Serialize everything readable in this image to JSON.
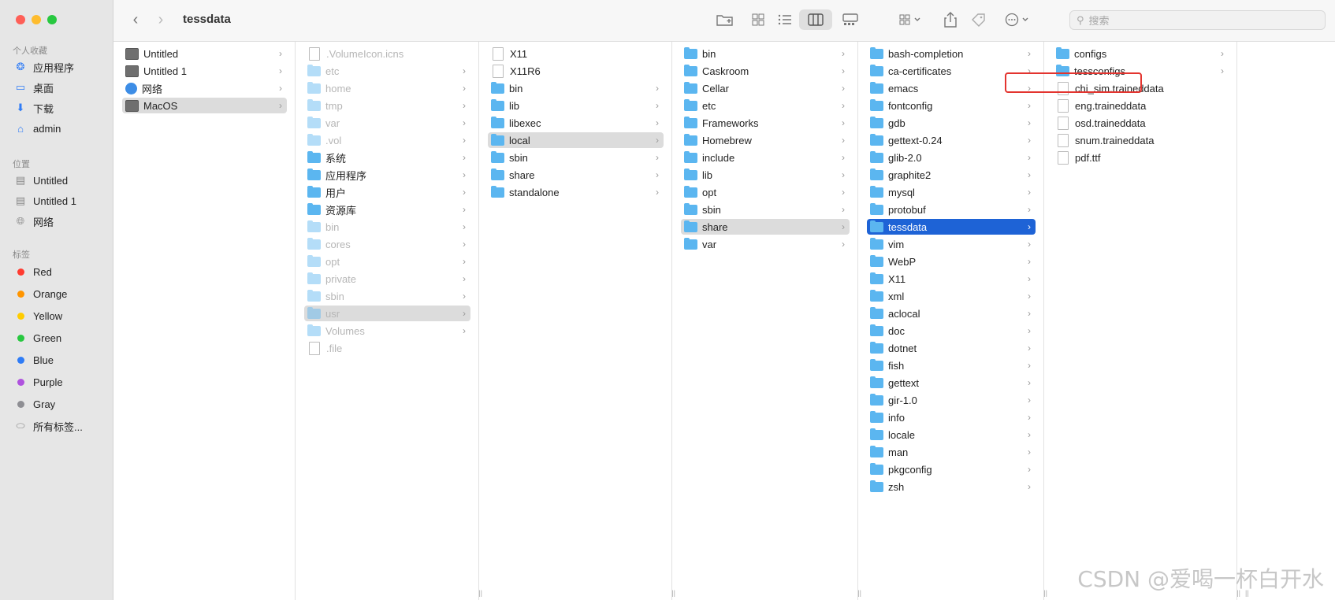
{
  "window": {
    "title": "tessdata"
  },
  "sidebar": {
    "favorites_label": "个人收藏",
    "favorites": [
      {
        "label": "应用程序",
        "icon": "apps-icon"
      },
      {
        "label": "桌面",
        "icon": "desktop-icon"
      },
      {
        "label": "下载",
        "icon": "download-icon"
      },
      {
        "label": "admin",
        "icon": "home-icon"
      }
    ],
    "locations_label": "位置",
    "locations": [
      {
        "label": "Untitled",
        "icon": "drive-icon"
      },
      {
        "label": "Untitled 1",
        "icon": "drive-icon"
      },
      {
        "label": "网络",
        "icon": "network-icon"
      }
    ],
    "tags_label": "标签",
    "tags": [
      {
        "label": "Red",
        "color": "#ff3b30"
      },
      {
        "label": "Orange",
        "color": "#ff9500"
      },
      {
        "label": "Yellow",
        "color": "#ffcc00"
      },
      {
        "label": "Green",
        "color": "#28c840"
      },
      {
        "label": "Blue",
        "color": "#2f7cf6"
      },
      {
        "label": "Purple",
        "color": "#af52de"
      },
      {
        "label": "Gray",
        "color": "#8e8e93"
      }
    ],
    "all_tags_label": "所有标签..."
  },
  "toolbar": {
    "search_placeholder": "搜索"
  },
  "columns": [
    {
      "items": [
        {
          "label": "Untitled",
          "kind": "disk",
          "chevron": true
        },
        {
          "label": "Untitled 1",
          "kind": "disk",
          "chevron": true
        },
        {
          "label": "网络",
          "kind": "globe",
          "chevron": true
        },
        {
          "label": "MacOS",
          "kind": "disk",
          "chevron": true,
          "state": "selected-gray"
        }
      ]
    },
    {
      "items": [
        {
          "label": ".VolumeIcon.icns",
          "kind": "file",
          "dim": true
        },
        {
          "label": "etc",
          "kind": "folder",
          "dim": true,
          "chevron": true
        },
        {
          "label": "home",
          "kind": "folder",
          "dim": true,
          "chevron": true
        },
        {
          "label": "tmp",
          "kind": "folder",
          "dim": true,
          "chevron": true
        },
        {
          "label": "var",
          "kind": "folder",
          "dim": true,
          "chevron": true
        },
        {
          "label": ".vol",
          "kind": "folder",
          "dim": true,
          "chevron": true
        },
        {
          "label": "系统",
          "kind": "folder",
          "chevron": true
        },
        {
          "label": "应用程序",
          "kind": "folder",
          "chevron": true
        },
        {
          "label": "用户",
          "kind": "folder",
          "chevron": true
        },
        {
          "label": "资源库",
          "kind": "folder",
          "chevron": true
        },
        {
          "label": "bin",
          "kind": "folder",
          "dim": true,
          "chevron": true
        },
        {
          "label": "cores",
          "kind": "folder",
          "dim": true,
          "chevron": true
        },
        {
          "label": "opt",
          "kind": "folder",
          "dim": true,
          "chevron": true
        },
        {
          "label": "private",
          "kind": "folder",
          "dim": true,
          "chevron": true
        },
        {
          "label": "sbin",
          "kind": "folder",
          "dim": true,
          "chevron": true
        },
        {
          "label": "usr",
          "kind": "folder",
          "dim": true,
          "chevron": true,
          "state": "selected-gray"
        },
        {
          "label": "Volumes",
          "kind": "folder",
          "dim": true,
          "chevron": true
        },
        {
          "label": ".file",
          "kind": "file",
          "dim": true
        }
      ]
    },
    {
      "items": [
        {
          "label": "X11",
          "kind": "file"
        },
        {
          "label": "X11R6",
          "kind": "file"
        },
        {
          "label": "bin",
          "kind": "folder",
          "chevron": true
        },
        {
          "label": "lib",
          "kind": "folder",
          "chevron": true
        },
        {
          "label": "libexec",
          "kind": "folder",
          "chevron": true
        },
        {
          "label": "local",
          "kind": "folder",
          "chevron": true,
          "state": "selected-gray"
        },
        {
          "label": "sbin",
          "kind": "folder",
          "chevron": true
        },
        {
          "label": "share",
          "kind": "folder",
          "chevron": true
        },
        {
          "label": "standalone",
          "kind": "folder",
          "chevron": true
        }
      ]
    },
    {
      "items": [
        {
          "label": "bin",
          "kind": "folder",
          "chevron": true
        },
        {
          "label": "Caskroom",
          "kind": "folder",
          "chevron": true
        },
        {
          "label": "Cellar",
          "kind": "folder",
          "chevron": true
        },
        {
          "label": "etc",
          "kind": "folder",
          "chevron": true
        },
        {
          "label": "Frameworks",
          "kind": "folder",
          "chevron": true
        },
        {
          "label": "Homebrew",
          "kind": "folder",
          "chevron": true
        },
        {
          "label": "include",
          "kind": "folder",
          "chevron": true
        },
        {
          "label": "lib",
          "kind": "folder",
          "chevron": true
        },
        {
          "label": "opt",
          "kind": "folder",
          "chevron": true
        },
        {
          "label": "sbin",
          "kind": "folder",
          "chevron": true
        },
        {
          "label": "share",
          "kind": "folder",
          "chevron": true,
          "state": "selected-gray"
        },
        {
          "label": "var",
          "kind": "folder",
          "chevron": true
        }
      ]
    },
    {
      "items": [
        {
          "label": "bash-completion",
          "kind": "folder",
          "chevron": true
        },
        {
          "label": "ca-certificates",
          "kind": "folder",
          "chevron": true
        },
        {
          "label": "emacs",
          "kind": "folder",
          "chevron": true
        },
        {
          "label": "fontconfig",
          "kind": "folder",
          "chevron": true
        },
        {
          "label": "gdb",
          "kind": "folder",
          "chevron": true
        },
        {
          "label": "gettext-0.24",
          "kind": "folder",
          "chevron": true
        },
        {
          "label": "glib-2.0",
          "kind": "folder",
          "chevron": true
        },
        {
          "label": "graphite2",
          "kind": "folder",
          "chevron": true
        },
        {
          "label": "mysql",
          "kind": "folder",
          "chevron": true
        },
        {
          "label": "protobuf",
          "kind": "folder",
          "chevron": true
        },
        {
          "label": "tessdata",
          "kind": "folder",
          "chevron": true,
          "state": "selected-blue"
        },
        {
          "label": "vim",
          "kind": "folder",
          "chevron": true
        },
        {
          "label": "WebP",
          "kind": "folder",
          "chevron": true
        },
        {
          "label": "X11",
          "kind": "folder",
          "chevron": true
        },
        {
          "label": "xml",
          "kind": "folder",
          "chevron": true
        },
        {
          "label": "aclocal",
          "kind": "folder",
          "chevron": true
        },
        {
          "label": "doc",
          "kind": "folder",
          "chevron": true
        },
        {
          "label": "dotnet",
          "kind": "folder",
          "chevron": true
        },
        {
          "label": "fish",
          "kind": "folder",
          "chevron": true
        },
        {
          "label": "gettext",
          "kind": "folder",
          "chevron": true
        },
        {
          "label": "gir-1.0",
          "kind": "folder",
          "chevron": true
        },
        {
          "label": "info",
          "kind": "folder",
          "chevron": true
        },
        {
          "label": "locale",
          "kind": "folder",
          "chevron": true
        },
        {
          "label": "man",
          "kind": "folder",
          "chevron": true
        },
        {
          "label": "pkgconfig",
          "kind": "folder",
          "chevron": true
        },
        {
          "label": "zsh",
          "kind": "folder",
          "chevron": true
        }
      ]
    },
    {
      "items": [
        {
          "label": "configs",
          "kind": "folder",
          "chevron": true
        },
        {
          "label": "tessconfigs",
          "kind": "folder",
          "chevron": true
        },
        {
          "label": "chi_sim.traineddata",
          "kind": "file",
          "highlight": true
        },
        {
          "label": "eng.traineddata",
          "kind": "file"
        },
        {
          "label": "osd.traineddata",
          "kind": "file"
        },
        {
          "label": "snum.traineddata",
          "kind": "file"
        },
        {
          "label": "pdf.ttf",
          "kind": "file"
        }
      ]
    }
  ],
  "watermark": "CSDN @爱喝一杯白开水"
}
